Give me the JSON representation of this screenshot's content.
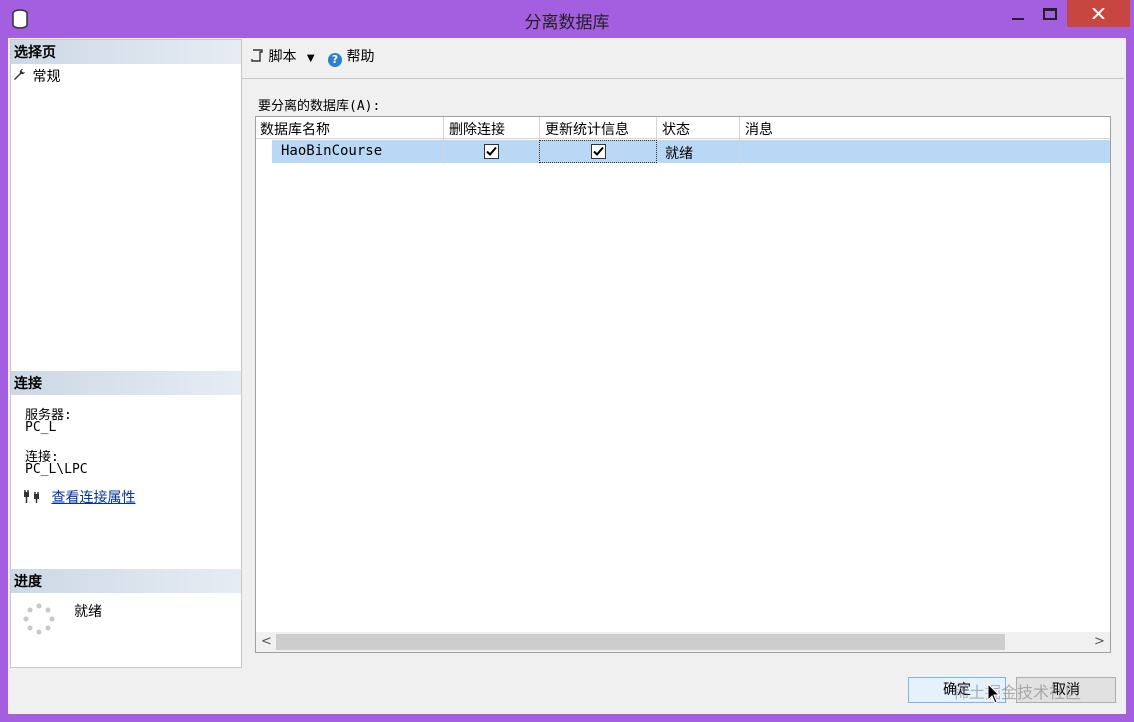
{
  "window": {
    "title": "分离数据库",
    "icon": "database-icon"
  },
  "left_pane": {
    "select_page_header": "选择页",
    "pages": [
      {
        "label": "常规",
        "icon": "wrench-icon"
      }
    ],
    "connection_header": "连接",
    "server_label": "服务器:",
    "server_value": "PC_L",
    "connection_label": "连接:",
    "connection_value": "PC_L\\LPC",
    "view_properties_link": "查看连接属性",
    "progress_header": "进度",
    "progress_status": "就绪"
  },
  "toolbar": {
    "script_label": "脚本",
    "help_label": "帮助"
  },
  "main": {
    "databases_label": "要分离的数据库(A):",
    "columns": [
      "数据库名称",
      "删除连接",
      "更新统计信息",
      "状态",
      "消息"
    ],
    "rows": [
      {
        "name": "HaoBinCourse",
        "drop_connections": true,
        "update_statistics": true,
        "status": "就绪",
        "message": ""
      }
    ]
  },
  "buttons": {
    "ok": "确定",
    "cancel": "取消"
  },
  "watermark": "稀土掘金技术社区",
  "colors": {
    "window_frame": "#a45ee0",
    "close_button": "#c7463f",
    "selected_row": "#b8d8f6",
    "link": "#0033aa"
  }
}
